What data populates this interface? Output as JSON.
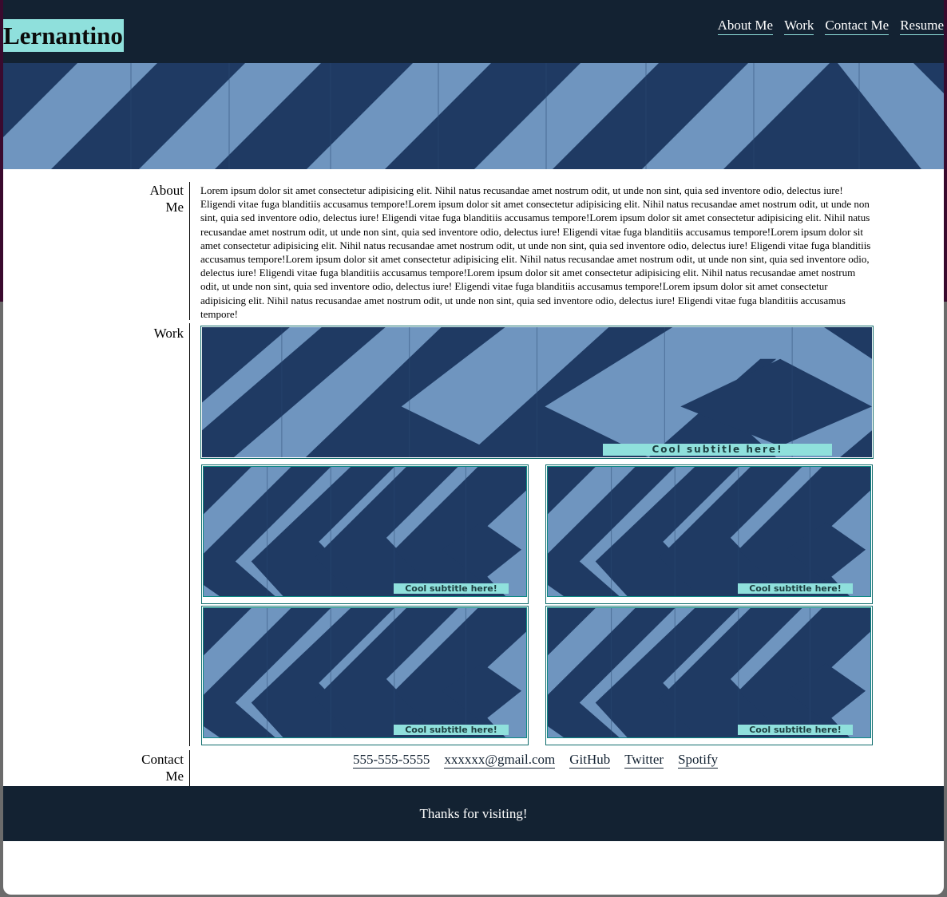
{
  "brand": {
    "title": "Lernantino"
  },
  "nav": {
    "items": [
      {
        "label": "About Me"
      },
      {
        "label": "Work"
      },
      {
        "label": "Contact Me"
      },
      {
        "label": "Resume"
      }
    ]
  },
  "sections": {
    "about": {
      "label_line1": "About",
      "label_line2": "Me",
      "text": "Lorem ipsum dolor sit amet consectetur adipisicing elit. Nihil natus recusandae amet nostrum odit, ut unde non sint, quia sed inventore odio, delectus iure! Eligendi vitae fuga blanditiis accusamus tempore!Lorem ipsum dolor sit amet consectetur adipisicing elit. Nihil natus recusandae amet nostrum odit, ut unde non sint, quia sed inventore odio, delectus iure! Eligendi vitae fuga blanditiis accusamus tempore!Lorem ipsum dolor sit amet consectetur adipisicing elit. Nihil natus recusandae amet nostrum odit, ut unde non sint, quia sed inventore odio, delectus iure! Eligendi vitae fuga blanditiis accusamus tempore!Lorem ipsum dolor sit amet consectetur adipisicing elit. Nihil natus recusandae amet nostrum odit, ut unde non sint, quia sed inventore odio, delectus iure! Eligendi vitae fuga blanditiis accusamus tempore!Lorem ipsum dolor sit amet consectetur adipisicing elit. Nihil natus recusandae amet nostrum odit, ut unde non sint, quia sed inventore odio, delectus iure! Eligendi vitae fuga blanditiis accusamus tempore!Lorem ipsum dolor sit amet consectetur adipisicing elit. Nihil natus recusandae amet nostrum odit, ut unde non sint, quia sed inventore odio, delectus iure! Eligendi vitae fuga blanditiis accusamus tempore!Lorem ipsum dolor sit amet consectetur adipisicing elit. Nihil natus recusandae amet nostrum odit, ut unde non sint, quia sed inventore odio, delectus iure! Eligendi vitae fuga blanditiis accusamus tempore!"
    },
    "work": {
      "label": "Work",
      "items": [
        {
          "subtitle": "Cool subtitle here!"
        },
        {
          "subtitle": "Cool subtitle here!"
        },
        {
          "subtitle": "Cool subtitle here!"
        },
        {
          "subtitle": "Cool subtitle here!"
        },
        {
          "subtitle": "Cool subtitle here!"
        }
      ]
    },
    "contact": {
      "label_line1": "Contact",
      "label_line2": "Me",
      "links": [
        {
          "label": "555-555-5555"
        },
        {
          "label": "xxxxxx@gmail.com"
        },
        {
          "label": "GitHub"
        },
        {
          "label": "Twitter"
        },
        {
          "label": "Spotify"
        }
      ]
    }
  },
  "footer": {
    "text": "Thanks for visiting!"
  },
  "colors": {
    "header_bg": "#132232",
    "accent": "#8fe0dc",
    "stripe_light": "#6f95bf",
    "stripe_dark": "#1f3a63"
  },
  "icons": []
}
